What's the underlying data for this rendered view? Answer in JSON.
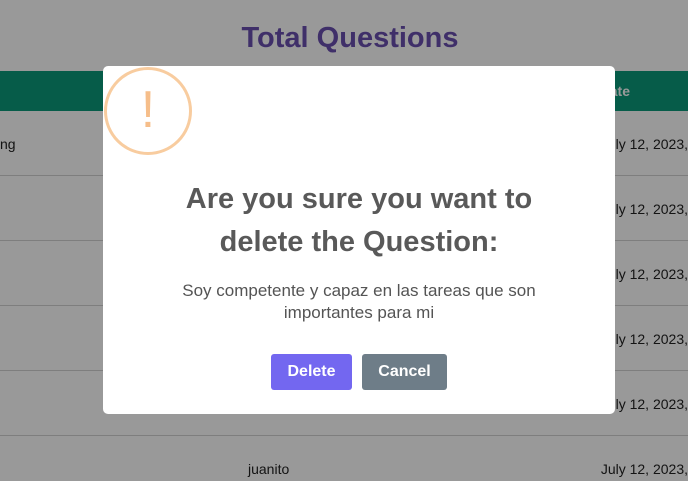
{
  "page": {
    "title": "Total Questions"
  },
  "table": {
    "header_date": "ate",
    "rows": [
      {
        "user": "ng",
        "date": "ly 12, 2023,"
      },
      {
        "user": "",
        "date": "ly 12, 2023,"
      },
      {
        "user": "",
        "date": "ly 12, 2023,"
      },
      {
        "user": "",
        "date": "ly 12, 2023,"
      },
      {
        "user": "",
        "date": "ly 12, 2023,"
      },
      {
        "user": "juanito",
        "date": "July 12, 2023,"
      }
    ]
  },
  "modal": {
    "icon": "warning-icon",
    "icon_glyph": "!",
    "title": "Are you sure you want to delete the Question:",
    "text": "Soy competente y capaz en las tareas que son importantes para mi",
    "delete_label": "Delete",
    "cancel_label": "Cancel"
  },
  "colors": {
    "title": "#6a4fb0",
    "header": "#0b9a7a",
    "warning": "#f8cc9f",
    "delete_button": "#7367f0",
    "cancel_button": "#6e7d88"
  }
}
